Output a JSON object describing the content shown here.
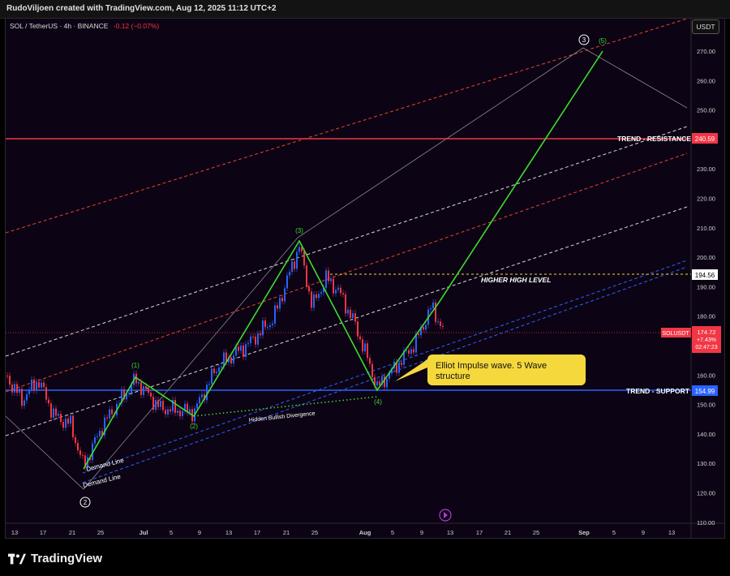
{
  "header": {
    "credit": "RudoViljoen created with TradingView.com, Aug 12, 2025 11:12 UTC+2"
  },
  "legend": {
    "symbol": "SOL / TetherUS · 4h · BINANCE",
    "change": "-0.12 (−0.07%)"
  },
  "currency_button": "USDT",
  "price_axis": {
    "ticks": [
      "270.00",
      "260.00",
      "250.00",
      "240.00",
      "230.00",
      "220.00",
      "210.00",
      "200.00",
      "190.00",
      "180.00",
      "170.00",
      "160.00",
      "150.00",
      "140.00",
      "130.00",
      "120.00",
      "110.00"
    ]
  },
  "time_axis": {
    "ticks": [
      "13",
      "17",
      "21",
      "25",
      "Jul",
      "5",
      "9",
      "13",
      "17",
      "21",
      "25",
      "Aug",
      "5",
      "9",
      "13",
      "17",
      "21",
      "25",
      "Sep",
      "5",
      "9",
      "13"
    ]
  },
  "price_labels": {
    "resistance": "240.59",
    "higher_high": "194.56",
    "current_symbol": "SOLUSDT",
    "current_price": "174.72",
    "current_change": "+7.43%",
    "countdown": "02:47:23",
    "support": "154.99"
  },
  "annotations": {
    "resistance_label": "TREND - RESISTANCE",
    "higher_high_label": "HIGHER HIGH LEVEL",
    "support_label": "TREND - SUPPORT",
    "divergence_label": "Hidden Bullish Divergence",
    "demand_line_1": "Demand Line",
    "demand_line_2": "Demand Line",
    "wave_1": "(1)",
    "wave_2": "(2)",
    "wave_3": "(3)",
    "wave_4": "(4)",
    "wave_5": "(5)",
    "circle_2": "2",
    "circle_3": "3",
    "callout": [
      "Elliot Impulse wave. 5 Wave",
      "structure"
    ]
  },
  "brand": "TradingView",
  "colors": {
    "resistance": "#f23645",
    "support": "#2962ff",
    "wave": "#3ddc2f",
    "callout_bg": "#f5d93c",
    "up_candle": "#2962ff",
    "down_candle": "#f23645"
  }
}
